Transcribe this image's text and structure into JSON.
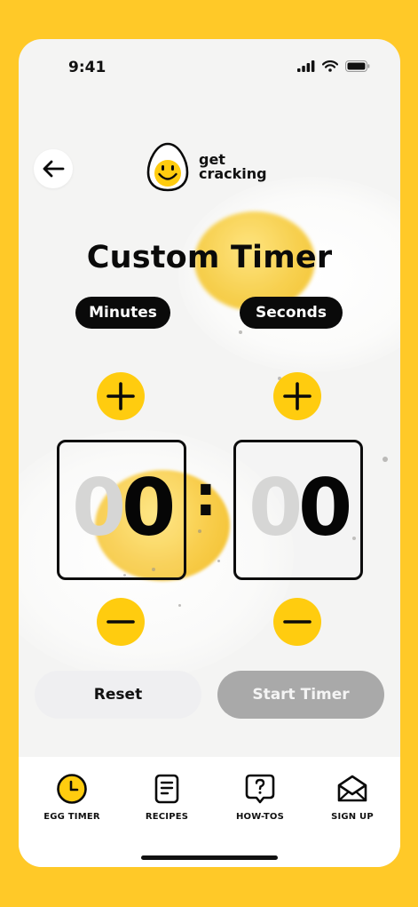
{
  "status_bar": {
    "time": "9:41"
  },
  "brand": {
    "line1": "get",
    "line2": "cracking"
  },
  "page": {
    "title": "Custom Timer"
  },
  "labels": {
    "minutes": "Minutes",
    "seconds": "Seconds"
  },
  "timer": {
    "minutes_ghost": "0",
    "minutes_value": "0",
    "separator": ":",
    "seconds_ghost": "0",
    "seconds_value": "0"
  },
  "actions": {
    "reset": "Reset",
    "start": "Start Timer"
  },
  "tabs": [
    {
      "label": "EGG TIMER",
      "icon": "clock-icon",
      "active": true
    },
    {
      "label": "RECIPES",
      "icon": "document-icon",
      "active": false
    },
    {
      "label": "HOW-TOS",
      "icon": "question-bubble-icon",
      "active": false
    },
    {
      "label": "SIGN UP",
      "icon": "envelope-icon",
      "active": false
    }
  ],
  "colors": {
    "accent": "#FFCC0F",
    "frame": "#FFC928",
    "dark": "#0A0A0A",
    "disabled": "#A9A9A9"
  }
}
